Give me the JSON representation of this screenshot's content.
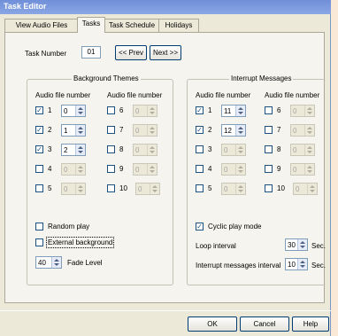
{
  "window": {
    "title": "Task Editor"
  },
  "tabs": [
    {
      "label": "View Audio Files",
      "active": false
    },
    {
      "label": "Tasks",
      "active": true
    },
    {
      "label": "Task Schedule",
      "active": false
    },
    {
      "label": "Holidays",
      "active": false
    }
  ],
  "task": {
    "label": "Task Number",
    "value": "01",
    "prev": "<< Prev",
    "next": "Next >>"
  },
  "background": {
    "title": "Background Themes",
    "col_header": "Audio file number",
    "left": [
      {
        "n": "1",
        "checked": true,
        "value": "0",
        "enabled": true
      },
      {
        "n": "2",
        "checked": true,
        "value": "1",
        "enabled": true
      },
      {
        "n": "3",
        "checked": true,
        "value": "2",
        "enabled": true
      },
      {
        "n": "4",
        "checked": false,
        "value": "0",
        "enabled": false
      },
      {
        "n": "5",
        "checked": false,
        "value": "0",
        "enabled": false
      }
    ],
    "right": [
      {
        "n": "6",
        "checked": false,
        "value": "0",
        "enabled": false
      },
      {
        "n": "7",
        "checked": false,
        "value": "0",
        "enabled": false
      },
      {
        "n": "8",
        "checked": false,
        "value": "0",
        "enabled": false
      },
      {
        "n": "9",
        "checked": false,
        "value": "0",
        "enabled": false
      },
      {
        "n": "10",
        "checked": false,
        "value": "0",
        "enabled": false
      }
    ],
    "random_play": "Random play",
    "external_background": "External background",
    "fade_value": "40",
    "fade_label": "Fade Level"
  },
  "interrupt": {
    "title": "Interrupt Messages",
    "col_header": "Audio file number",
    "left": [
      {
        "n": "1",
        "checked": true,
        "value": "11",
        "enabled": true
      },
      {
        "n": "2",
        "checked": true,
        "value": "12",
        "enabled": true
      },
      {
        "n": "3",
        "checked": false,
        "value": "0",
        "enabled": false
      },
      {
        "n": "4",
        "checked": false,
        "value": "0",
        "enabled": false
      },
      {
        "n": "5",
        "checked": false,
        "value": "0",
        "enabled": false
      }
    ],
    "right": [
      {
        "n": "6",
        "checked": false,
        "value": "0",
        "enabled": false
      },
      {
        "n": "7",
        "checked": false,
        "value": "0",
        "enabled": false
      },
      {
        "n": "8",
        "checked": false,
        "value": "0",
        "enabled": false
      },
      {
        "n": "9",
        "checked": false,
        "value": "0",
        "enabled": false
      },
      {
        "n": "10",
        "checked": false,
        "value": "0",
        "enabled": false
      }
    ],
    "cyclic_play": "Cyclic play mode",
    "loop_label": "Loop interval",
    "loop_value": "30",
    "loop_unit": "Sec.",
    "interval_label": "Interrupt messages interval",
    "interval_value": "10",
    "interval_unit": "Sec."
  },
  "footer": {
    "ok": "OK",
    "cancel": "Cancel",
    "help": "Help"
  }
}
